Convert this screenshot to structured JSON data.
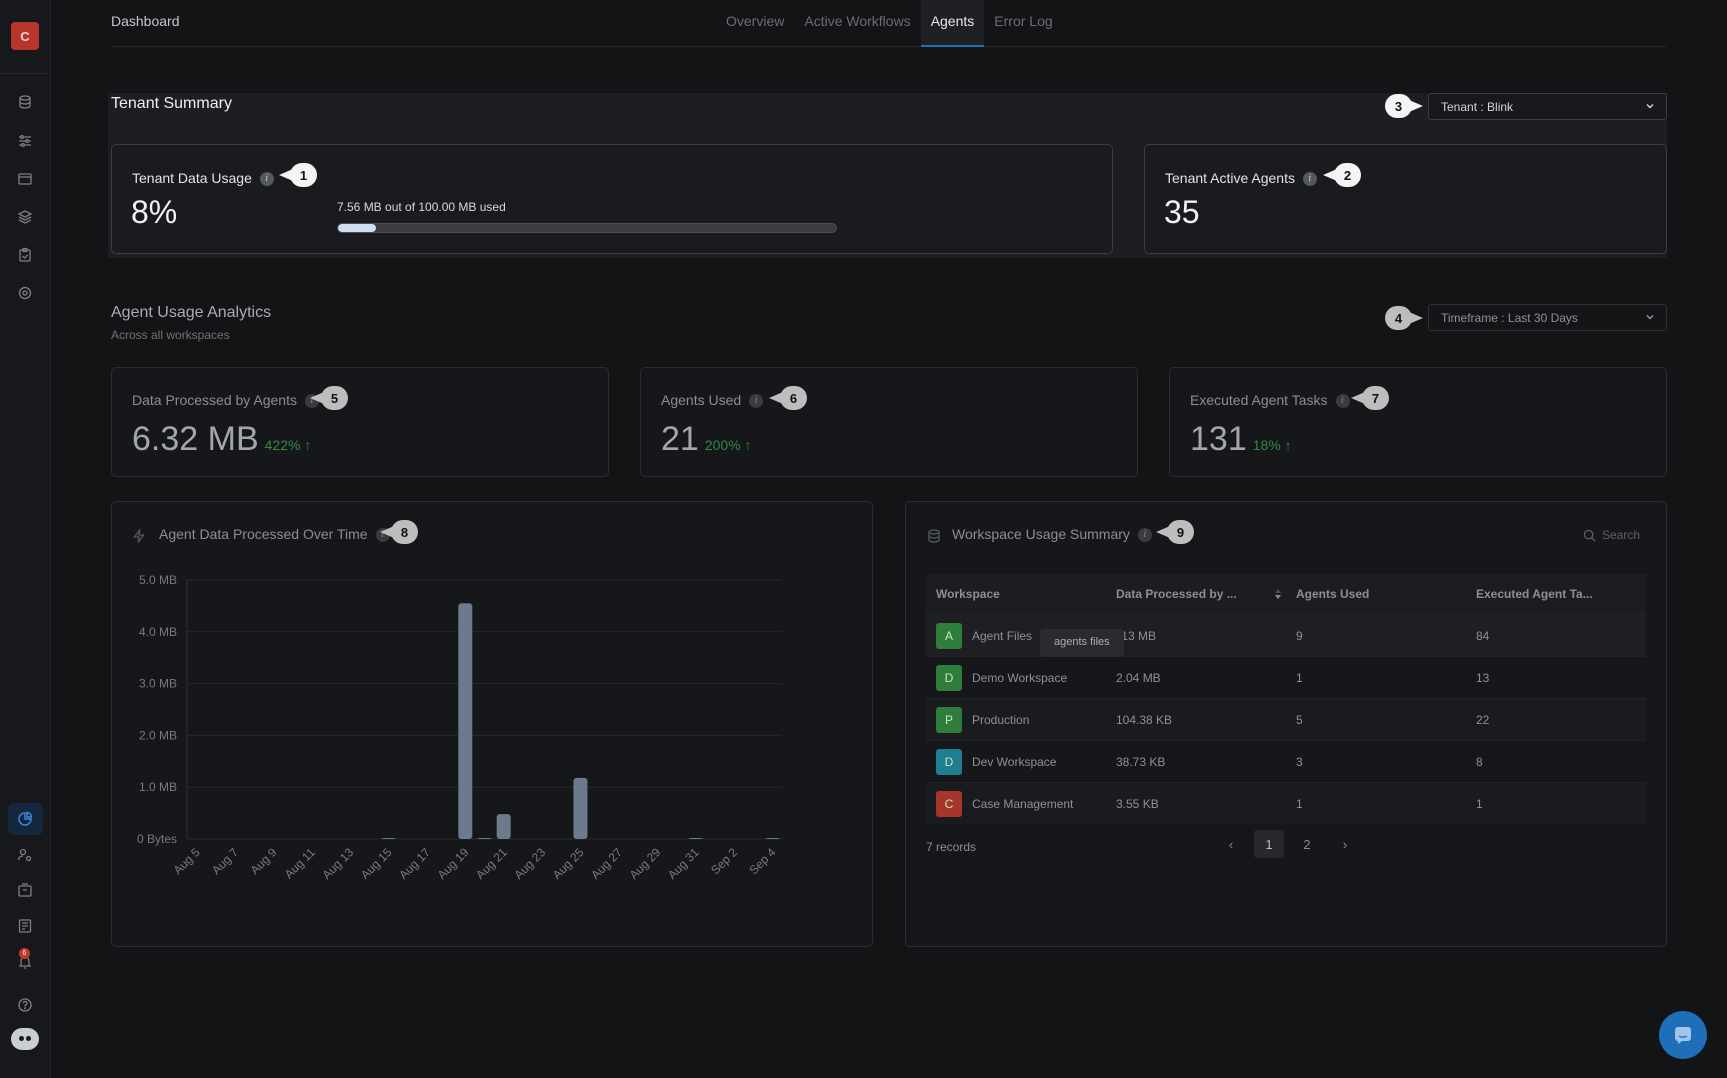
{
  "brand": {
    "letter": "C",
    "color": "#b8352c"
  },
  "sidebar": {
    "top_icons": [
      "database-icon",
      "sliders-icon",
      "window-icon",
      "layers-icon",
      "clipboard-icon",
      "target-icon"
    ],
    "bottom_icons": [
      "pie-chart-icon",
      "user-gear-icon",
      "inbox-icon",
      "document-list-icon",
      "notification-icon",
      "help-icon",
      "bot-icon"
    ],
    "notification_badge": "6"
  },
  "header": {
    "title": "Dashboard",
    "tabs": [
      {
        "label": "Overview",
        "active": false
      },
      {
        "label": "Active Workflows",
        "active": false
      },
      {
        "label": "Agents",
        "active": true
      },
      {
        "label": "Error Log",
        "active": false
      }
    ]
  },
  "tenant_summary": {
    "title": "Tenant Summary",
    "tenant_select": "Tenant : Blink",
    "data_usage": {
      "label": "Tenant Data Usage",
      "value": "8%",
      "usage_text": "7.56 MB out of 100.00 MB used",
      "progress_fraction": 0.0756
    },
    "active_agents": {
      "label": "Tenant Active Agents",
      "value": "35"
    }
  },
  "callouts": [
    "1",
    "2",
    "3",
    "4",
    "5",
    "6",
    "7",
    "8",
    "9"
  ],
  "analytics": {
    "title": "Agent Usage Analytics",
    "subtitle": "Across all workspaces",
    "timeframe_select": "Timeframe : Last 30 Days",
    "stats": [
      {
        "label": "Data Processed by Agents",
        "value": "6.32 MB",
        "delta": "422%"
      },
      {
        "label": "Agents Used",
        "value": "21",
        "delta": "200%"
      },
      {
        "label": "Executed Agent Tasks",
        "value": "131",
        "delta": "18%"
      }
    ]
  },
  "chart_panel": {
    "title": "Agent Data Processed Over Time"
  },
  "chart_data": {
    "type": "bar",
    "title": "Agent Data Processed Over Time",
    "ylabel": "",
    "xlabel": "",
    "y_unit": "MB",
    "ylim": [
      0,
      5
    ],
    "y_ticks": [
      "0 Bytes",
      "1.0 MB",
      "2.0 MB",
      "3.0 MB",
      "4.0 MB",
      "5.0 MB"
    ],
    "x_ticks": [
      "Aug 5",
      "Aug 7",
      "Aug 9",
      "Aug 11",
      "Aug 13",
      "Aug 15",
      "Aug 17",
      "Aug 19",
      "Aug 21",
      "Aug 23",
      "Aug 25",
      "Aug 27",
      "Aug 29",
      "Aug 31",
      "Sep 2",
      "Sep 4"
    ],
    "categories": [
      "Aug 5",
      "Aug 6",
      "Aug 7",
      "Aug 8",
      "Aug 9",
      "Aug 10",
      "Aug 11",
      "Aug 12",
      "Aug 13",
      "Aug 14",
      "Aug 15",
      "Aug 16",
      "Aug 17",
      "Aug 18",
      "Aug 19",
      "Aug 20",
      "Aug 21",
      "Aug 22",
      "Aug 23",
      "Aug 24",
      "Aug 25",
      "Aug 26",
      "Aug 27",
      "Aug 28",
      "Aug 29",
      "Aug 30",
      "Aug 31",
      "Sep 1",
      "Sep 2",
      "Sep 3",
      "Sep 4"
    ],
    "values": [
      0,
      0,
      0,
      0,
      0,
      0,
      0,
      0,
      0,
      0,
      0.01,
      0,
      0,
      0,
      4.55,
      0.01,
      0.48,
      0,
      0,
      0,
      1.18,
      0,
      0,
      0,
      0,
      0,
      0.01,
      0,
      0,
      0,
      0.01
    ],
    "bar_color": "#6b7a8c",
    "grid": true
  },
  "workspace_panel": {
    "title": "Workspace Usage Summary",
    "search_placeholder": "Search",
    "columns": [
      "Workspace",
      "Data Processed by ...",
      "Agents Used",
      "Executed Agent Ta..."
    ],
    "rows": [
      {
        "avatar": "A",
        "color": "#2f7d3a",
        "name": "Agent Files",
        "data": ".13 MB",
        "agents": "9",
        "tasks": "84"
      },
      {
        "avatar": "D",
        "color": "#2f7d3a",
        "name": "Demo Workspace",
        "data": "2.04 MB",
        "agents": "1",
        "tasks": "13"
      },
      {
        "avatar": "P",
        "color": "#2f7d3a",
        "name": "Production",
        "data": "104.38 KB",
        "agents": "5",
        "tasks": "22"
      },
      {
        "avatar": "D",
        "color": "#1d7f8f",
        "name": "Dev Workspace",
        "data": "38.73 KB",
        "agents": "3",
        "tasks": "8"
      },
      {
        "avatar": "C",
        "color": "#a8352c",
        "name": "Case Management",
        "data": "3.55 KB",
        "agents": "1",
        "tasks": "1"
      }
    ],
    "tooltip": "agents files",
    "records": "7 records",
    "pages": [
      "1",
      "2"
    ],
    "current_page": "1"
  }
}
